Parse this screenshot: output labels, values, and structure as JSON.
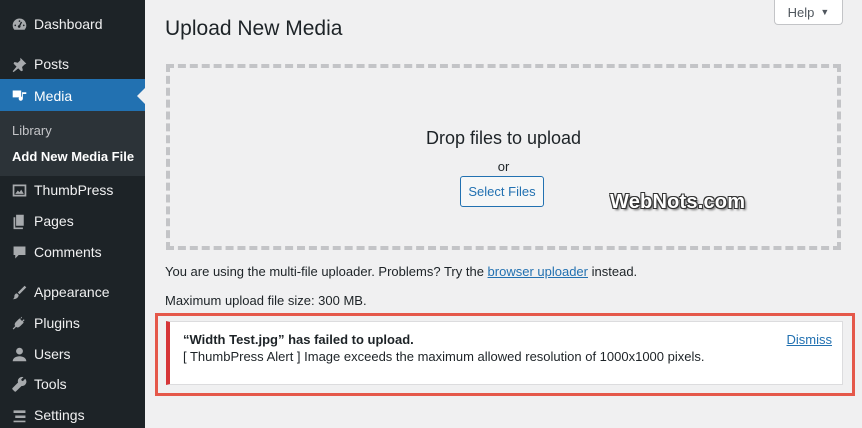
{
  "sidebar": {
    "items": [
      {
        "label": "Dashboard",
        "icon": "dashboard-icon"
      },
      {
        "label": "Posts",
        "icon": "pin-icon"
      },
      {
        "label": "Media",
        "icon": "media-icon"
      },
      {
        "label": "ThumbPress",
        "icon": "image-icon"
      },
      {
        "label": "Pages",
        "icon": "pages-icon"
      },
      {
        "label": "Comments",
        "icon": "comment-icon"
      },
      {
        "label": "Appearance",
        "icon": "brush-icon"
      },
      {
        "label": "Plugins",
        "icon": "plugin-icon"
      },
      {
        "label": "Users",
        "icon": "user-icon"
      },
      {
        "label": "Tools",
        "icon": "wrench-icon"
      },
      {
        "label": "Settings",
        "icon": "settings-icon"
      }
    ],
    "submenu": [
      {
        "label": "Library"
      },
      {
        "label": "Add New Media File"
      }
    ]
  },
  "header": {
    "help_label": "Help",
    "title": "Upload New Media"
  },
  "dropzone": {
    "title": "Drop files to upload",
    "or": "or",
    "button": "Select Files"
  },
  "watermark": "WebNots.com",
  "info": {
    "before": "You are using the multi-file uploader. Problems? Try the",
    "link": "browser uploader",
    "after": "instead.",
    "max_size": "Maximum upload file size: 300 MB."
  },
  "notice": {
    "title": "“Width Test.jpg” has failed to upload.",
    "message": "[ ThumbPress Alert ] Image exceeds the maximum allowed resolution of 1000x1000 pixels.",
    "dismiss": "Dismiss"
  },
  "colors": {
    "sidebar_bg": "#1d2327",
    "accent": "#2271b1",
    "error": "#d63638",
    "highlight": "#e5584a"
  }
}
